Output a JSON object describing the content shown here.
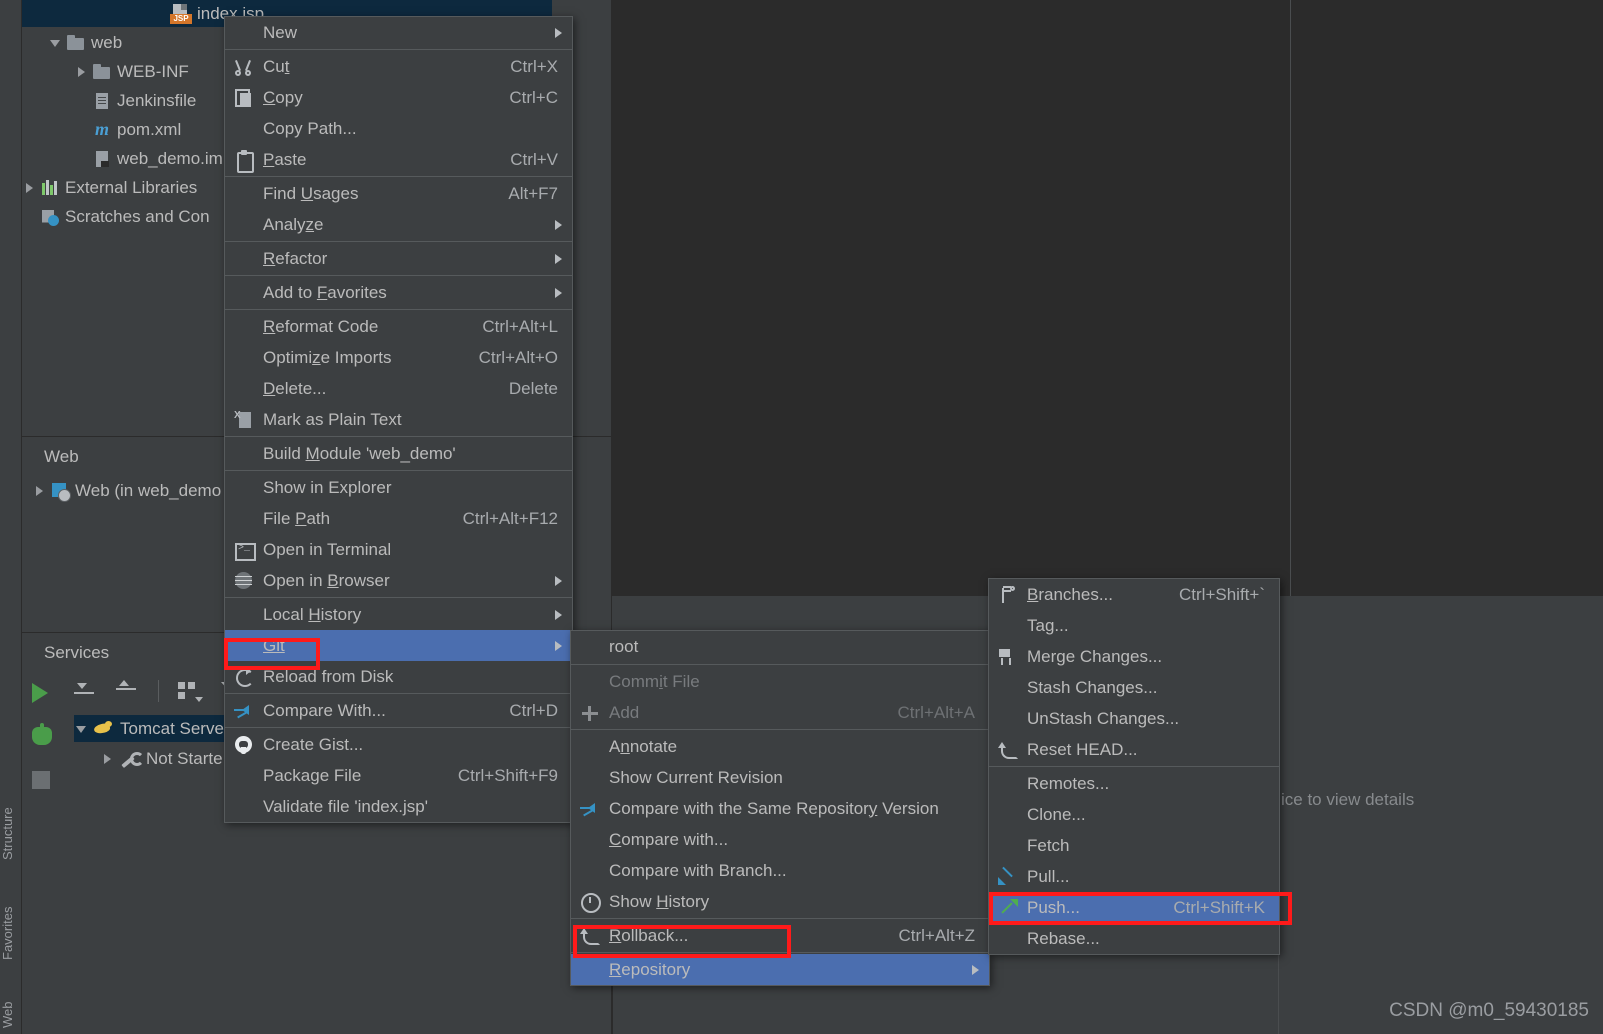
{
  "app": {
    "watermark": "CSDN @m0_59430185"
  },
  "left_toolbar_labels": [
    "Structure",
    "Favorites",
    "Web"
  ],
  "project_tree": {
    "items": [
      {
        "label": "index.jsp",
        "icon": "jsp-file-icon",
        "selected": true,
        "indent": 0,
        "arrow": "none"
      },
      {
        "label": "web",
        "icon": "folder-icon",
        "selected": false,
        "indent": 1,
        "arrow": "down"
      },
      {
        "label": "WEB-INF",
        "icon": "folder-icon",
        "selected": false,
        "indent": 2,
        "arrow": "right"
      },
      {
        "label": "Jenkinsfile",
        "icon": "file-icon",
        "selected": false,
        "indent": 2,
        "arrow": "none"
      },
      {
        "label": "pom.xml",
        "icon": "maven-icon",
        "selected": false,
        "indent": 2,
        "arrow": "none"
      },
      {
        "label": "web_demo.iml",
        "icon": "iml-file-icon",
        "selected": false,
        "indent": 2,
        "arrow": "none"
      },
      {
        "label": "External Libraries",
        "icon": "library-icon",
        "selected": false,
        "indent": 0,
        "arrow": "right"
      },
      {
        "label": "Scratches and Con",
        "icon": "scratches-icon",
        "selected": false,
        "indent": 0,
        "arrow": "none"
      }
    ]
  },
  "web_panel": {
    "title": "Web",
    "item_label": "Web (in web_demo"
  },
  "services_panel": {
    "title": "Services",
    "toolbar": [
      "run-icon",
      "debug-icon",
      "stop-icon",
      "expand-all-icon",
      "collapse-all-icon",
      "group-by-icon",
      "filter-icon"
    ],
    "tree": [
      {
        "label": "Tomcat Serve",
        "icon": "tomcat-icon",
        "arrow": "down",
        "selected": true
      },
      {
        "label": "Not Starte",
        "icon": "wrench-icon",
        "arrow": "right",
        "selected": false
      }
    ],
    "detail_hint": "ice to view details"
  },
  "context_menu": {
    "name": "file-context-menu",
    "items": [
      {
        "label": "New",
        "mnemonic": "",
        "shortcut": "",
        "submenu": true,
        "icon": "",
        "disabled": false
      },
      {
        "sep": true
      },
      {
        "label": "Cut",
        "mnemonic": "t",
        "shortcut": "Ctrl+X",
        "submenu": false,
        "icon": "cut-icon",
        "disabled": false
      },
      {
        "label": "Copy",
        "mnemonic": "C",
        "shortcut": "Ctrl+C",
        "submenu": false,
        "icon": "copy-icon",
        "disabled": false
      },
      {
        "label": "Copy Path...",
        "mnemonic": "",
        "shortcut": "",
        "submenu": false,
        "icon": "",
        "disabled": false
      },
      {
        "label": "Paste",
        "mnemonic": "P",
        "shortcut": "Ctrl+V",
        "submenu": false,
        "icon": "paste-icon",
        "disabled": false
      },
      {
        "sep": true
      },
      {
        "label": "Find Usages",
        "mnemonic": "U",
        "shortcut": "Alt+F7",
        "submenu": false,
        "icon": "",
        "disabled": false
      },
      {
        "label": "Analyze",
        "mnemonic": "z",
        "shortcut": "",
        "submenu": true,
        "icon": "",
        "disabled": false
      },
      {
        "sep": true
      },
      {
        "label": "Refactor",
        "mnemonic": "R",
        "shortcut": "",
        "submenu": true,
        "icon": "",
        "disabled": false
      },
      {
        "sep": true
      },
      {
        "label": "Add to Favorites",
        "mnemonic": "F",
        "shortcut": "",
        "submenu": true,
        "icon": "",
        "disabled": false
      },
      {
        "sep": true
      },
      {
        "label": "Reformat Code",
        "mnemonic": "R",
        "shortcut": "Ctrl+Alt+L",
        "submenu": false,
        "icon": "",
        "disabled": false
      },
      {
        "label": "Optimize Imports",
        "mnemonic": "z",
        "shortcut": "Ctrl+Alt+O",
        "submenu": false,
        "icon": "",
        "disabled": false
      },
      {
        "label": "Delete...",
        "mnemonic": "D",
        "shortcut": "Delete",
        "submenu": false,
        "icon": "",
        "disabled": false
      },
      {
        "label": "Mark as Plain Text",
        "mnemonic": "",
        "shortcut": "",
        "submenu": false,
        "icon": "plain-text-icon",
        "disabled": false
      },
      {
        "sep": true
      },
      {
        "label": "Build Module 'web_demo'",
        "mnemonic": "M",
        "shortcut": "",
        "submenu": false,
        "icon": "",
        "disabled": false
      },
      {
        "sep": true
      },
      {
        "label": "Show in Explorer",
        "mnemonic": "",
        "shortcut": "",
        "submenu": false,
        "icon": "",
        "disabled": false
      },
      {
        "label": "File Path",
        "mnemonic": "P",
        "shortcut": "Ctrl+Alt+F12",
        "submenu": false,
        "icon": "",
        "disabled": false
      },
      {
        "label": "Open in Terminal",
        "mnemonic": "",
        "shortcut": "",
        "submenu": false,
        "icon": "terminal-icon",
        "disabled": false
      },
      {
        "label": "Open in Browser",
        "mnemonic": "B",
        "shortcut": "",
        "submenu": true,
        "icon": "browser-icon",
        "disabled": false
      },
      {
        "sep": true
      },
      {
        "label": "Local History",
        "mnemonic": "H",
        "shortcut": "",
        "submenu": true,
        "icon": "",
        "disabled": false
      },
      {
        "label": "Git",
        "mnemonic": "Git",
        "shortcut": "",
        "submenu": true,
        "icon": "",
        "disabled": false,
        "selected": true,
        "highlighted": true
      },
      {
        "label": "Reload from Disk",
        "mnemonic": "",
        "shortcut": "",
        "submenu": false,
        "icon": "reload-icon",
        "disabled": false
      },
      {
        "sep": true
      },
      {
        "label": "Compare With...",
        "mnemonic": "",
        "shortcut": "Ctrl+D",
        "submenu": false,
        "icon": "compare-icon",
        "disabled": false
      },
      {
        "sep": true
      },
      {
        "label": "Create Gist...",
        "mnemonic": "",
        "shortcut": "",
        "submenu": false,
        "icon": "github-icon",
        "disabled": false
      },
      {
        "label": "Package File",
        "mnemonic": "",
        "shortcut": "Ctrl+Shift+F9",
        "submenu": false,
        "icon": "",
        "disabled": false
      },
      {
        "label": "Validate file 'index.jsp'",
        "mnemonic": "",
        "shortcut": "",
        "submenu": false,
        "icon": "",
        "disabled": false
      }
    ]
  },
  "git_submenu": {
    "name": "git-submenu",
    "header": "root",
    "items": [
      {
        "label": "Commit File",
        "mnemonic": "i",
        "shortcut": "",
        "submenu": false,
        "icon": "",
        "disabled": true
      },
      {
        "label": "Add",
        "mnemonic": "",
        "shortcut": "Ctrl+Alt+A",
        "submenu": false,
        "icon": "plus-icon",
        "disabled": true
      },
      {
        "sep": true
      },
      {
        "label": "Annotate",
        "mnemonic": "n",
        "shortcut": "",
        "submenu": false,
        "icon": "",
        "disabled": false
      },
      {
        "label": "Show Current Revision",
        "mnemonic": "",
        "shortcut": "",
        "submenu": false,
        "icon": "",
        "disabled": false
      },
      {
        "label": "Compare with the Same Repository Version",
        "mnemonic": "y",
        "shortcut": "",
        "submenu": false,
        "icon": "compare-icon",
        "disabled": false
      },
      {
        "label": "Compare with...",
        "mnemonic": "C",
        "shortcut": "",
        "submenu": false,
        "icon": "",
        "disabled": false
      },
      {
        "label": "Compare with Branch...",
        "mnemonic": "",
        "shortcut": "",
        "submenu": false,
        "icon": "",
        "disabled": false
      },
      {
        "label": "Show History",
        "mnemonic": "H",
        "shortcut": "",
        "submenu": false,
        "icon": "clock-icon",
        "disabled": false
      },
      {
        "sep": true
      },
      {
        "label": "Rollback...",
        "mnemonic": "R",
        "shortcut": "Ctrl+Alt+Z",
        "submenu": false,
        "icon": "rollback-icon",
        "disabled": false
      },
      {
        "sep": true
      },
      {
        "label": "Repository",
        "mnemonic": "R",
        "shortcut": "",
        "submenu": true,
        "icon": "",
        "disabled": false,
        "selected": true,
        "highlighted": true
      }
    ]
  },
  "repository_submenu": {
    "name": "repository-submenu",
    "items": [
      {
        "label": "Branches...",
        "mnemonic": "B",
        "shortcut": "Ctrl+Shift+`",
        "submenu": false,
        "icon": "branch-icon",
        "disabled": false
      },
      {
        "label": "Tag...",
        "mnemonic": "",
        "shortcut": "",
        "submenu": false,
        "icon": "",
        "disabled": false
      },
      {
        "label": "Merge Changes...",
        "mnemonic": "",
        "shortcut": "",
        "submenu": false,
        "icon": "merge-icon",
        "disabled": false
      },
      {
        "label": "Stash Changes...",
        "mnemonic": "",
        "shortcut": "",
        "submenu": false,
        "icon": "",
        "disabled": false
      },
      {
        "label": "UnStash Changes...",
        "mnemonic": "",
        "shortcut": "",
        "submenu": false,
        "icon": "",
        "disabled": false
      },
      {
        "label": "Reset HEAD...",
        "mnemonic": "",
        "shortcut": "",
        "submenu": false,
        "icon": "rollback-icon",
        "disabled": false
      },
      {
        "sep": true
      },
      {
        "label": "Remotes...",
        "mnemonic": "",
        "shortcut": "",
        "submenu": false,
        "icon": "",
        "disabled": false
      },
      {
        "label": "Clone...",
        "mnemonic": "",
        "shortcut": "",
        "submenu": false,
        "icon": "",
        "disabled": false
      },
      {
        "label": "Fetch",
        "mnemonic": "",
        "shortcut": "",
        "submenu": false,
        "icon": "",
        "disabled": false
      },
      {
        "label": "Pull...",
        "mnemonic": "",
        "shortcut": "",
        "submenu": false,
        "icon": "pull-icon",
        "disabled": false
      },
      {
        "label": "Push...",
        "mnemonic": "",
        "shortcut": "Ctrl+Shift+K",
        "submenu": false,
        "icon": "push-icon",
        "disabled": false,
        "selected": true,
        "highlighted": true
      },
      {
        "label": "Rebase...",
        "mnemonic": "",
        "shortcut": "",
        "submenu": false,
        "icon": "",
        "disabled": false
      }
    ]
  },
  "colors": {
    "menu_bg": "#3c3f41",
    "selection": "#4b6eaf",
    "highlight_box": "#ff1a1a",
    "editor_bg": "#2b2b2b",
    "text": "#bbbbbb",
    "disabled_text": "#787b7e",
    "tree_selected": "#0d293e"
  }
}
